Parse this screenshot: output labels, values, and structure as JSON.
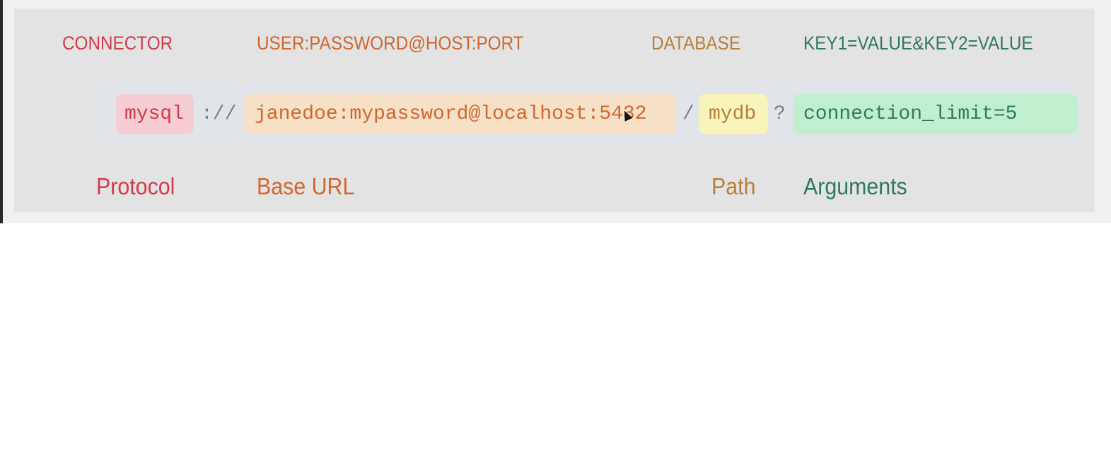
{
  "headers": {
    "connector": "CONNECTOR",
    "base": "USER:PASSWORD@HOST:PORT",
    "database": "DATABASE",
    "args": "KEY1=VALUE&KEY2=VALUE"
  },
  "url": {
    "protocol": "mysql",
    "sep1": "://",
    "base": "janedoe:mypassword@localhost:5432",
    "sep2": "/",
    "path": "mydb",
    "sep3": "?",
    "args": "connection_limit=5"
  },
  "captions": {
    "protocol": "Protocol",
    "base": "Base URL",
    "path": "Path",
    "args": "Arguments"
  },
  "colors": {
    "protocol": "#d33a4b",
    "base": "#d0672f",
    "path": "#b5803c",
    "args": "#2f7a5c"
  }
}
